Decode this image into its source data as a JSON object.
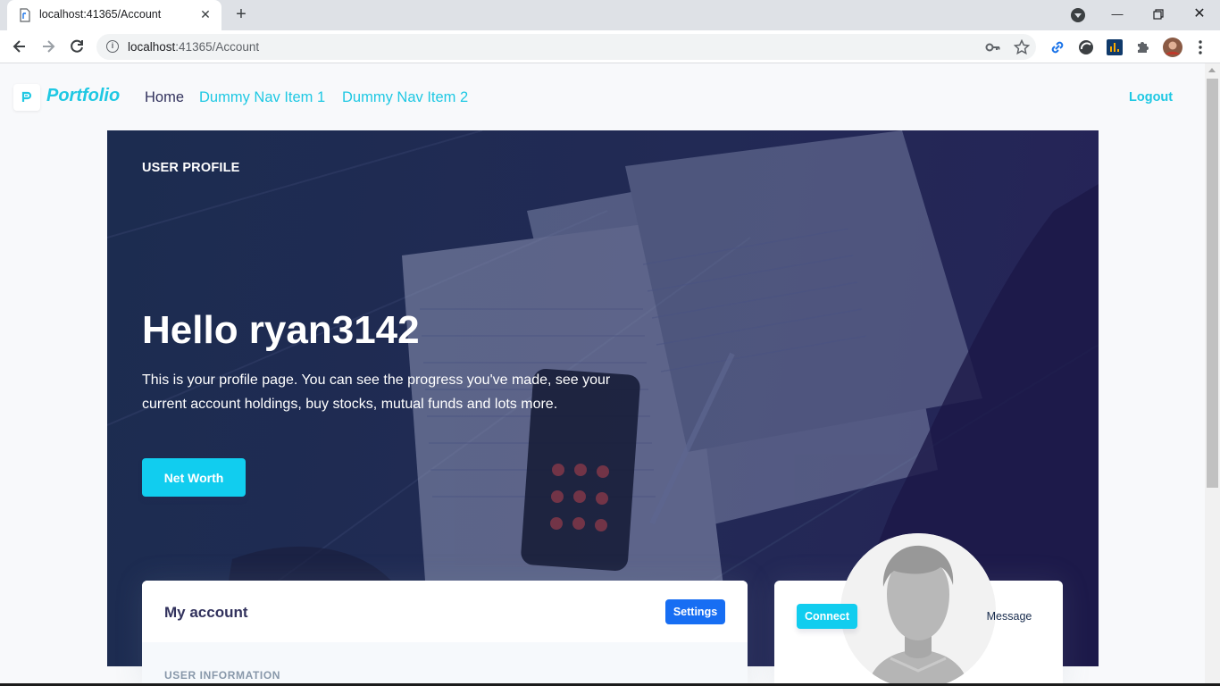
{
  "browser": {
    "tab_title": "localhost:41365/Account",
    "url_host": "localhost",
    "url_path": ":41365/Account",
    "icons": [
      "page-icon",
      "close-icon",
      "plus-icon",
      "back-icon",
      "forward-icon",
      "reload-icon",
      "info-icon",
      "key-icon",
      "star-icon",
      "link-icon",
      "extension-icon",
      "puzzle-icon",
      "avatar-icon",
      "more-icon"
    ]
  },
  "navbar": {
    "brand": "Portfolio",
    "links": [
      "Home",
      "Dummy Nav Item 1",
      "Dummy Nav Item 2"
    ],
    "logout": "Logout"
  },
  "hero": {
    "kicker": "USER PROFILE",
    "title": "Hello ryan3142",
    "text": "This is your profile page. You can see the progress you've made, see your current account holdings, buy stocks, mutual funds and lots more.",
    "button": "Net Worth"
  },
  "account_card": {
    "title": "My account",
    "settings": "Settings",
    "section": "USER INFORMATION"
  },
  "profile_card": {
    "connect": "Connect",
    "message": "Message"
  },
  "colors": {
    "accent": "#11cdef",
    "primary": "#176ef3",
    "hero_overlay": "#222a55"
  }
}
